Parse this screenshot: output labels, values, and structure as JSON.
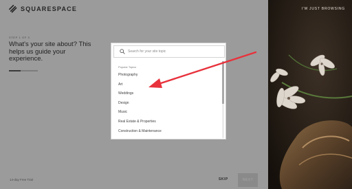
{
  "brand": {
    "name": "SQUARESPACE"
  },
  "header": {
    "browsing_link": "I'M JUST BROWSING"
  },
  "wizard": {
    "step_label": "STEP 1 OF 3",
    "headline": "What's your site about? This helps us guide your experience.",
    "progress": 0.4
  },
  "search": {
    "placeholder": "Search for your site topic",
    "value": ""
  },
  "topics": {
    "header": "Popular Topics",
    "items": [
      "Photography",
      "Art",
      "Weddings",
      "Design",
      "Music",
      "Real Estate & Properties",
      "Construction & Maintenance"
    ]
  },
  "footer": {
    "trial_text": "14-day Free Trial",
    "skip_label": "SKIP",
    "next_label": "NEXT"
  },
  "colors": {
    "overlay": "#9b9b9b",
    "arrow": "#e8323c",
    "panel_bg": "#ffffff"
  }
}
